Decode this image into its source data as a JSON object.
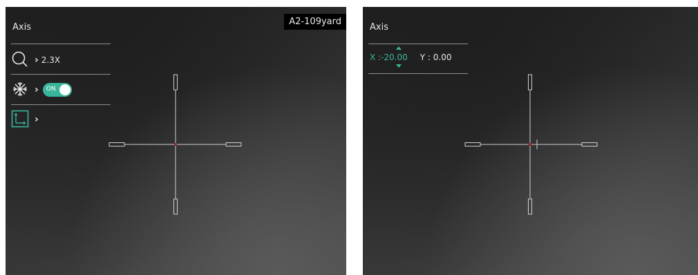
{
  "left_screen": {
    "menu_title": "Axis",
    "distance_label": "A2-109yard",
    "items": [
      {
        "icon": "magnifier-icon",
        "value": "2.3X"
      },
      {
        "icon": "snowflake-icon",
        "toggle_label": "ON"
      },
      {
        "icon": "axis-icon"
      }
    ]
  },
  "right_screen": {
    "menu_title": "Axis",
    "axis_x": "X :-20.00",
    "axis_y": "Y :  0.00"
  },
  "colors": {
    "accent": "#3ab59c",
    "crosshair_center": "#8a2b2b",
    "reticle_line": "#d0d0d0"
  }
}
